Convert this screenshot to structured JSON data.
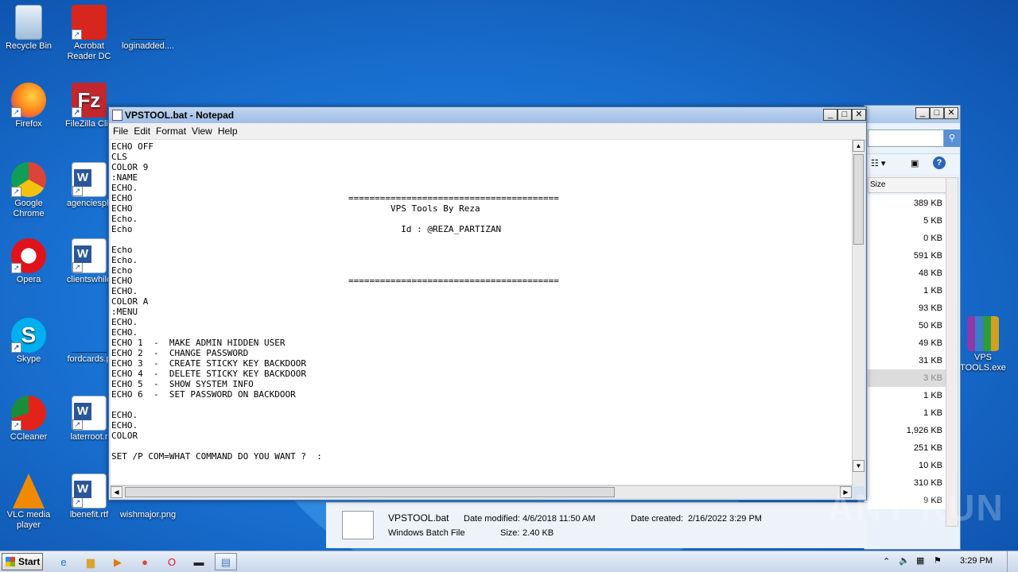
{
  "desktop": {
    "icons": [
      {
        "label": "Recycle Bin",
        "icon": "recycle-bin-icon"
      },
      {
        "label": "Acrobat Reader DC",
        "icon": "acrobat-icon"
      },
      {
        "label": "loginadded....",
        "icon": "file-icon"
      },
      {
        "label": "Firefox",
        "icon": "firefox-icon"
      },
      {
        "label": "FileZilla Clie",
        "icon": "filezilla-icon"
      },
      {
        "label": "Google Chrome",
        "icon": "chrome-icon"
      },
      {
        "label": "agenciesph",
        "icon": "word-doc-icon"
      },
      {
        "label": "Opera",
        "icon": "opera-icon"
      },
      {
        "label": "clientswhile",
        "icon": "word-doc-icon"
      },
      {
        "label": "Skype",
        "icon": "skype-icon"
      },
      {
        "label": "fordcards.p",
        "icon": "file-icon"
      },
      {
        "label": "CCleaner",
        "icon": "ccleaner-icon"
      },
      {
        "label": "laterroot.r",
        "icon": "word-doc-icon"
      },
      {
        "label": "VLC media player",
        "icon": "vlc-icon"
      },
      {
        "label": "lbenefit.rtf",
        "icon": "word-doc-icon"
      },
      {
        "label": "wishmajor.png",
        "icon": "image-file-icon"
      },
      {
        "label": "VPS TOOLS.exe",
        "icon": "winrar-icon"
      }
    ]
  },
  "notepad": {
    "title": "VPSTOOL.bat - Notepad",
    "menu": [
      "File",
      "Edit",
      "Format",
      "View",
      "Help"
    ],
    "content": "ECHO OFF\nCLS\nCOLOR 9\n:NAME\nECHO.\nECHO                                         ========================================\nECHO                                                 VPS Tools By Reza\nEcho.\nEcho                                                   Id : @REZA_PARTIZAN\n\nEcho\nEcho.\nEcho\nECHO                                         ========================================\nECHO.\nCOLOR A\n:MENU\nECHO.\nECHO.\nECHO 1  -  MAKE ADMIN HIDDEN USER\nECHO 2  -  CHANGE PASSWORD\nECHO 3  -  CREATE STICKY KEY BACKDOOR\nECHO 4  -  DELETE STICKY KEY BACKDOOR\nECHO 5  -  SHOW SYSTEM INFO\nECHO 6  -  SET PASSWORD ON BACKDOOR\n\nECHO.\nECHO.\nCOLOR\n\nSET /P COM=WHAT COMMAND DO YOU WANT ?  :"
  },
  "explorer": {
    "column_header": "Size",
    "sizes": [
      "389 KB",
      "5 KB",
      "0 KB",
      "591 KB",
      "48 KB",
      "1 KB",
      "93 KB",
      "50 KB",
      "49 KB",
      "31 KB",
      "3 KB",
      "1 KB",
      "1 KB",
      "1,926 KB",
      "251 KB",
      "10 KB",
      "310 KB",
      "9 KB"
    ],
    "selected_index": 10,
    "details": {
      "name": "VPSTOOL.bat",
      "type": "Windows Batch File",
      "modified_label": "Date modified:",
      "modified_value": "4/6/2018 11:50 AM",
      "size_label": "Size:",
      "size_value": "2.40 KB",
      "created_label": "Date created:",
      "created_value": "2/16/2022 3:29 PM"
    }
  },
  "taskbar": {
    "start_label": "Start",
    "clock": "3:29 PM"
  },
  "watermark": "ANY RUN"
}
